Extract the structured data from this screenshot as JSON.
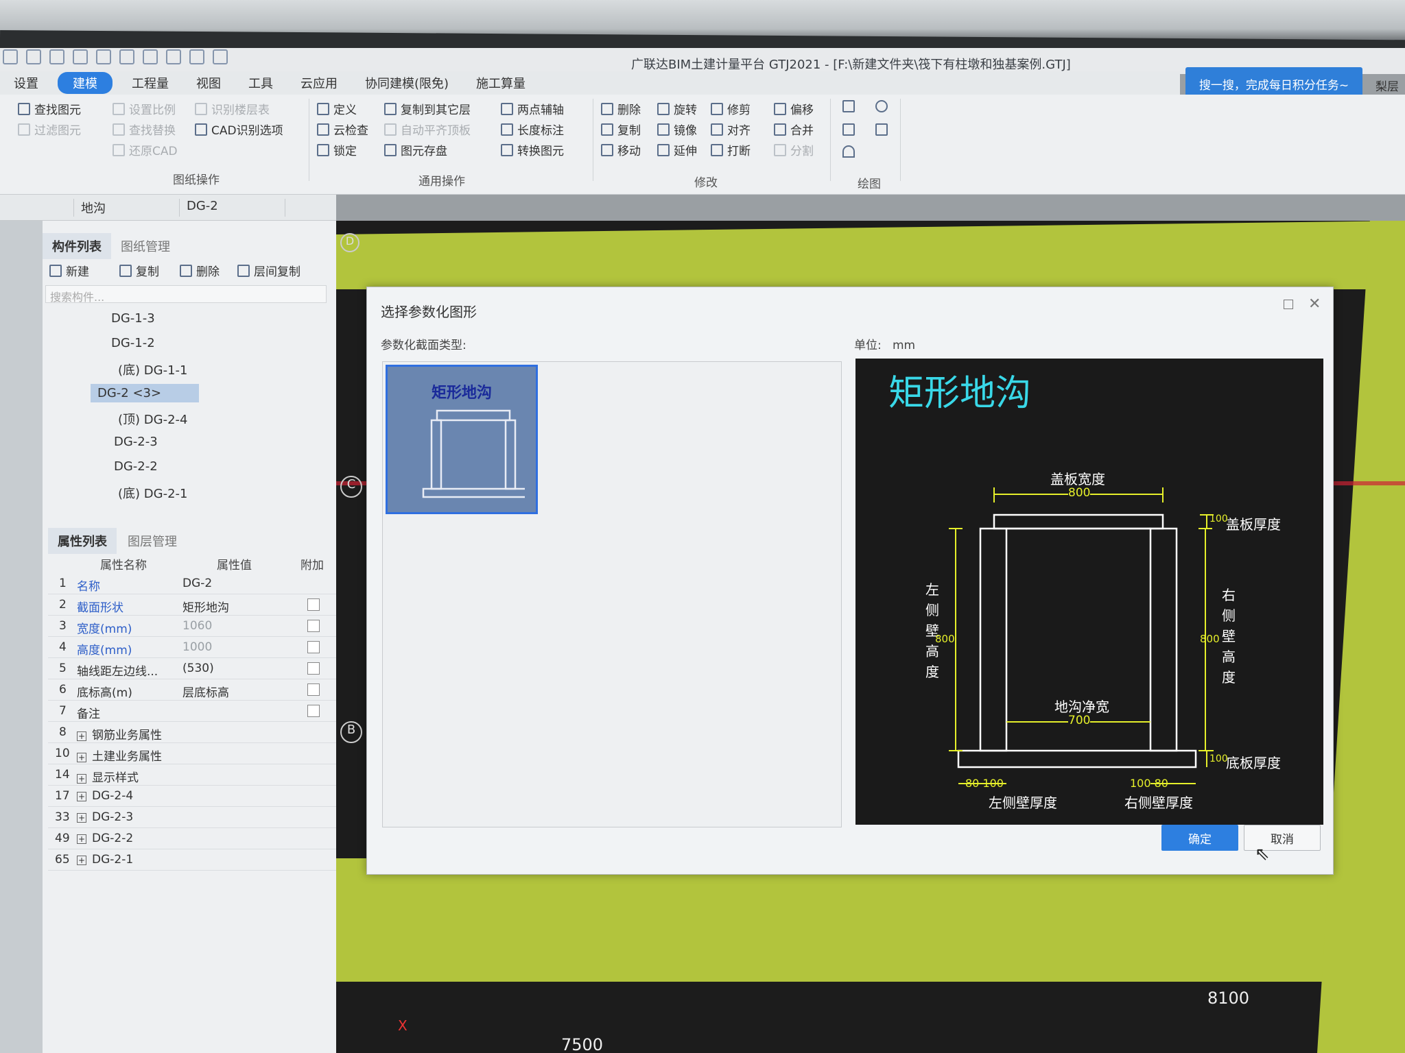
{
  "app": {
    "title": "广联达BIM土建计量平台 GTJ2021 - [F:\\新建文件夹\\筏下有柱墩和独基案例.GTJ]",
    "search_banner": "搜一搜，完成每日积分任务~",
    "user_label": "梨层三"
  },
  "menu": [
    "设置",
    "建模",
    "工程量",
    "视图",
    "工具",
    "云应用",
    "协同建模(限免)",
    "施工算量"
  ],
  "ribbon": {
    "drawing_ops": {
      "items": [
        "查找图元",
        "过滤图元",
        "设置比例",
        "查找替换",
        "还原CAD",
        "识别楼层表",
        "CAD识别选项"
      ],
      "group": "图纸操作"
    },
    "general_ops": {
      "items": [
        "定义",
        "云检查",
        "锁定",
        "复制到其它层",
        "自动平齐顶板",
        "图元存盘",
        "两点辅轴",
        "长度标注",
        "转换图元"
      ],
      "group": "通用操作"
    },
    "modify": {
      "items": [
        "删除",
        "复制",
        "移动",
        "旋转",
        "镜像",
        "延伸",
        "修剪",
        "对齐",
        "打断",
        "偏移",
        "合并",
        "分割"
      ],
      "group": "修改"
    },
    "draw": {
      "group": "绘图"
    }
  },
  "dropdowns": [
    "地沟",
    "DG-2"
  ],
  "component_panel": {
    "tabs": [
      "构件列表",
      "图纸管理"
    ],
    "toolbar": [
      "新建",
      "复制",
      "删除",
      "层间复制"
    ],
    "search_placeholder": "搜索构件...",
    "tree": [
      "DG-1-3",
      "DG-1-2",
      "(底) DG-1-1",
      "DG-2 <3>",
      "(顶) DG-2-4",
      "DG-2-3",
      "DG-2-2",
      "(底) DG-2-1"
    ]
  },
  "property_panel": {
    "tabs": [
      "属性列表",
      "图层管理"
    ],
    "headers": [
      "属性名称",
      "属性值",
      "附加"
    ],
    "rows": [
      {
        "no": "1",
        "name": "名称",
        "value": "DG-2"
      },
      {
        "no": "2",
        "name": "截面形状",
        "value": "矩形地沟"
      },
      {
        "no": "3",
        "name": "宽度(mm)",
        "value": "1060"
      },
      {
        "no": "4",
        "name": "高度(mm)",
        "value": "1000"
      },
      {
        "no": "5",
        "name": "轴线距左边线...",
        "value": "(530)"
      },
      {
        "no": "6",
        "name": "底标高(m)",
        "value": "层底标高"
      },
      {
        "no": "7",
        "name": "备注",
        "value": ""
      },
      {
        "no": "8",
        "name": "钢筋业务属性",
        "value": ""
      },
      {
        "no": "10",
        "name": "土建业务属性",
        "value": ""
      },
      {
        "no": "14",
        "name": "显示样式",
        "value": ""
      },
      {
        "no": "17",
        "name": "DG-2-4",
        "value": ""
      },
      {
        "no": "33",
        "name": "DG-2-3",
        "value": ""
      },
      {
        "no": "49",
        "name": "DG-2-2",
        "value": ""
      },
      {
        "no": "65",
        "name": "DG-2-1",
        "value": ""
      }
    ]
  },
  "canvas": {
    "axis_labels": [
      "D",
      "C",
      "B"
    ],
    "dims": [
      "7500",
      "8100"
    ],
    "axis_x": "X"
  },
  "dialog": {
    "title": "选择参数化图形",
    "section_label": "参数化截面类型:",
    "unit_label": "单位:",
    "unit_value": "mm",
    "thumbnail_title": "矩形地沟",
    "preview": {
      "title": "矩形地沟",
      "cover_width_label": "盖板宽度",
      "cover_width": "800",
      "cover_thickness_label": "盖板厚度",
      "cover_thickness": "100",
      "left_wall_label": "左侧壁高度",
      "left_wall_height": "800",
      "right_wall_label": "右侧壁高度",
      "right_wall_height": "800",
      "clear_width_label": "地沟净宽",
      "clear_width": "700",
      "base_thickness_label": "底板厚度",
      "base_thickness": "100",
      "left_thickness_label": "左侧壁厚度",
      "left_dims": "80 100",
      "right_thickness_label": "右侧壁厚度",
      "right_dims": "100 80"
    },
    "ok": "确定",
    "cancel": "取消"
  },
  "colors": {
    "accent": "#2d7fe0",
    "canvas_green": "#b2c43d",
    "preview_cyan": "#39d8e8",
    "dim_yellow": "#e6f02a"
  }
}
